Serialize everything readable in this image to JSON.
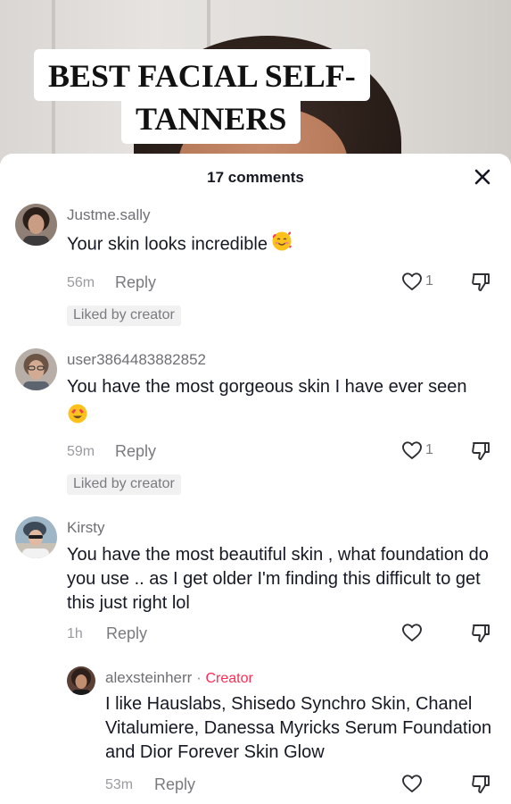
{
  "video": {
    "banner_line_1": "BEST FACIAL SELF-",
    "banner_line_2": "TANNERS"
  },
  "sheet": {
    "title": "17 comments",
    "close_icon": "close-icon"
  },
  "colors": {
    "creator_accent": "#fe2c55",
    "text_primary": "#161823",
    "text_secondary": "#7a7a80",
    "badge_bg": "#f1f1f2"
  },
  "comments": [
    {
      "username": "Justme.sally",
      "text": "Your skin looks incredible",
      "emoji": "smiling-face-with-hearts",
      "time": "56m",
      "reply_label": "Reply",
      "like_count": "1",
      "badge": "Liked by creator"
    },
    {
      "username": "user3864483882852",
      "text": "You have the most gorgeous skin I have ever seen",
      "emoji": "heart-eyes",
      "time": "59m",
      "reply_label": "Reply",
      "like_count": "1",
      "badge": "Liked by creator"
    },
    {
      "username": "Kirsty",
      "text": "You have the most beautiful skin , what foundation do you use .. as I get older I'm finding this difficult to get this just right lol",
      "time": "1h",
      "reply_label": "Reply"
    }
  ],
  "reply": {
    "username": "alexsteinherr",
    "separator": "·",
    "creator_label": "Creator",
    "text": "I like Hauslabs, Shisedo Synchro Skin, Chanel Vitalumiere, Danessa Myricks Serum Foundation and Dior Forever Skin Glow",
    "time": "53m",
    "reply_label": "Reply"
  }
}
